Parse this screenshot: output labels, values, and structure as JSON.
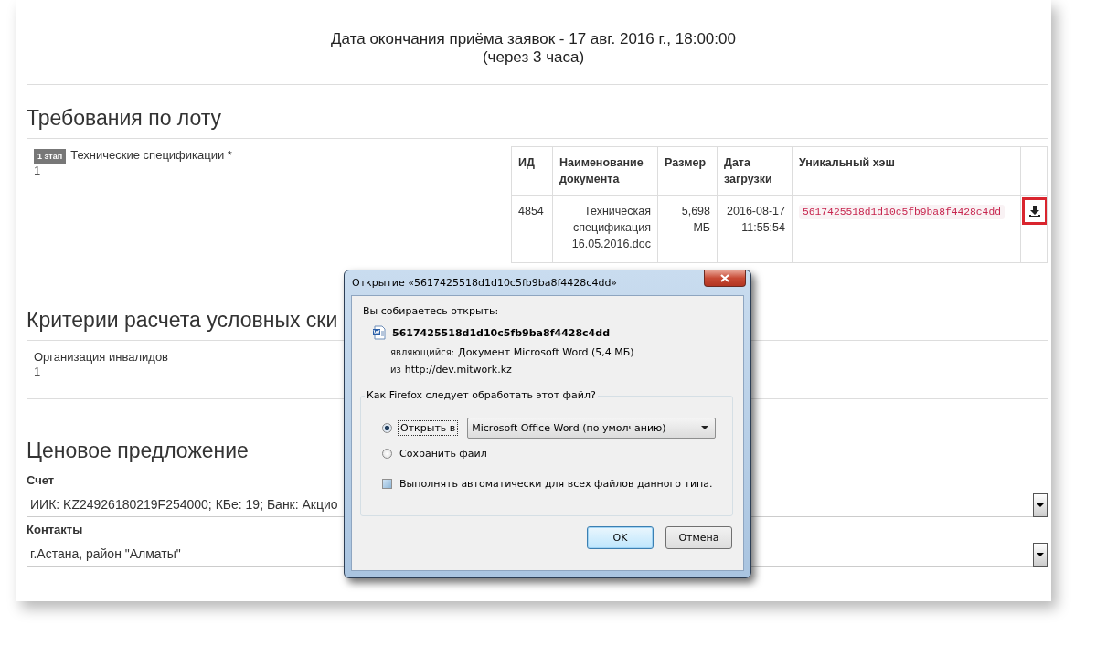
{
  "header": {
    "deadline": "Дата окончания приёма заявок - 17 авг. 2016 г., 18:00:00",
    "remaining": "(через 3 часа)"
  },
  "lot_requirements": {
    "title": "Требования по лоту",
    "items": [
      {
        "stage_badge": "1 этап",
        "name": "Технические спецификации *",
        "value": "1"
      }
    ],
    "documents_table": {
      "columns": [
        "ИД",
        "Наименование документа",
        "Размер",
        "Дата загрузки",
        "Уникальный хэш"
      ],
      "rows": [
        {
          "id": "4854",
          "name": "Техническая спецификация 16.05.2016.doc",
          "size": "5,698 МБ",
          "date": "2016-08-17 11:55:54",
          "hash": "5617425518d1d10c5fb9ba8f4428c4dd",
          "download_highlighted": true
        }
      ]
    }
  },
  "criteria": {
    "title": "Критерии расчета условных ски",
    "items": [
      {
        "name": "Организация инвалидов",
        "value": "1"
      }
    ]
  },
  "price_offer": {
    "title": "Ценовое предложение",
    "fields": [
      {
        "label": "Счет",
        "value": "ИИК: KZ24926180219F254000; КБе: 19; Банк: Акцио"
      },
      {
        "label": "Контакты",
        "value": "г.Астана, район \"Алматы\""
      }
    ]
  },
  "dialog": {
    "title": "Открытие «5617425518d1d10c5fb9ba8f4428c4dd»",
    "intro": "Вы собираетесь открыть:",
    "file_name": "5617425518d1d10c5fb9ba8f4428c4dd",
    "type_label": "являющийся:",
    "type_value": "Документ Microsoft Word (5,4 МБ)",
    "from_label": "из",
    "from_value": "http://dev.mitwork.kz",
    "question": "Как Firefox следует обработать этот файл?",
    "options": [
      {
        "kind": "open",
        "label": "Открыть в",
        "selected": true
      },
      {
        "kind": "save",
        "label": "Сохранить файл",
        "selected": false
      }
    ],
    "app_select": "Microsoft Office Word (по умолчанию)",
    "auto_checkbox": {
      "label": "Выполнять автоматически для всех файлов данного типа.",
      "checked": false
    },
    "buttons": [
      {
        "label": "OK",
        "default": true
      },
      {
        "label": "Отмена",
        "default": false
      }
    ]
  }
}
